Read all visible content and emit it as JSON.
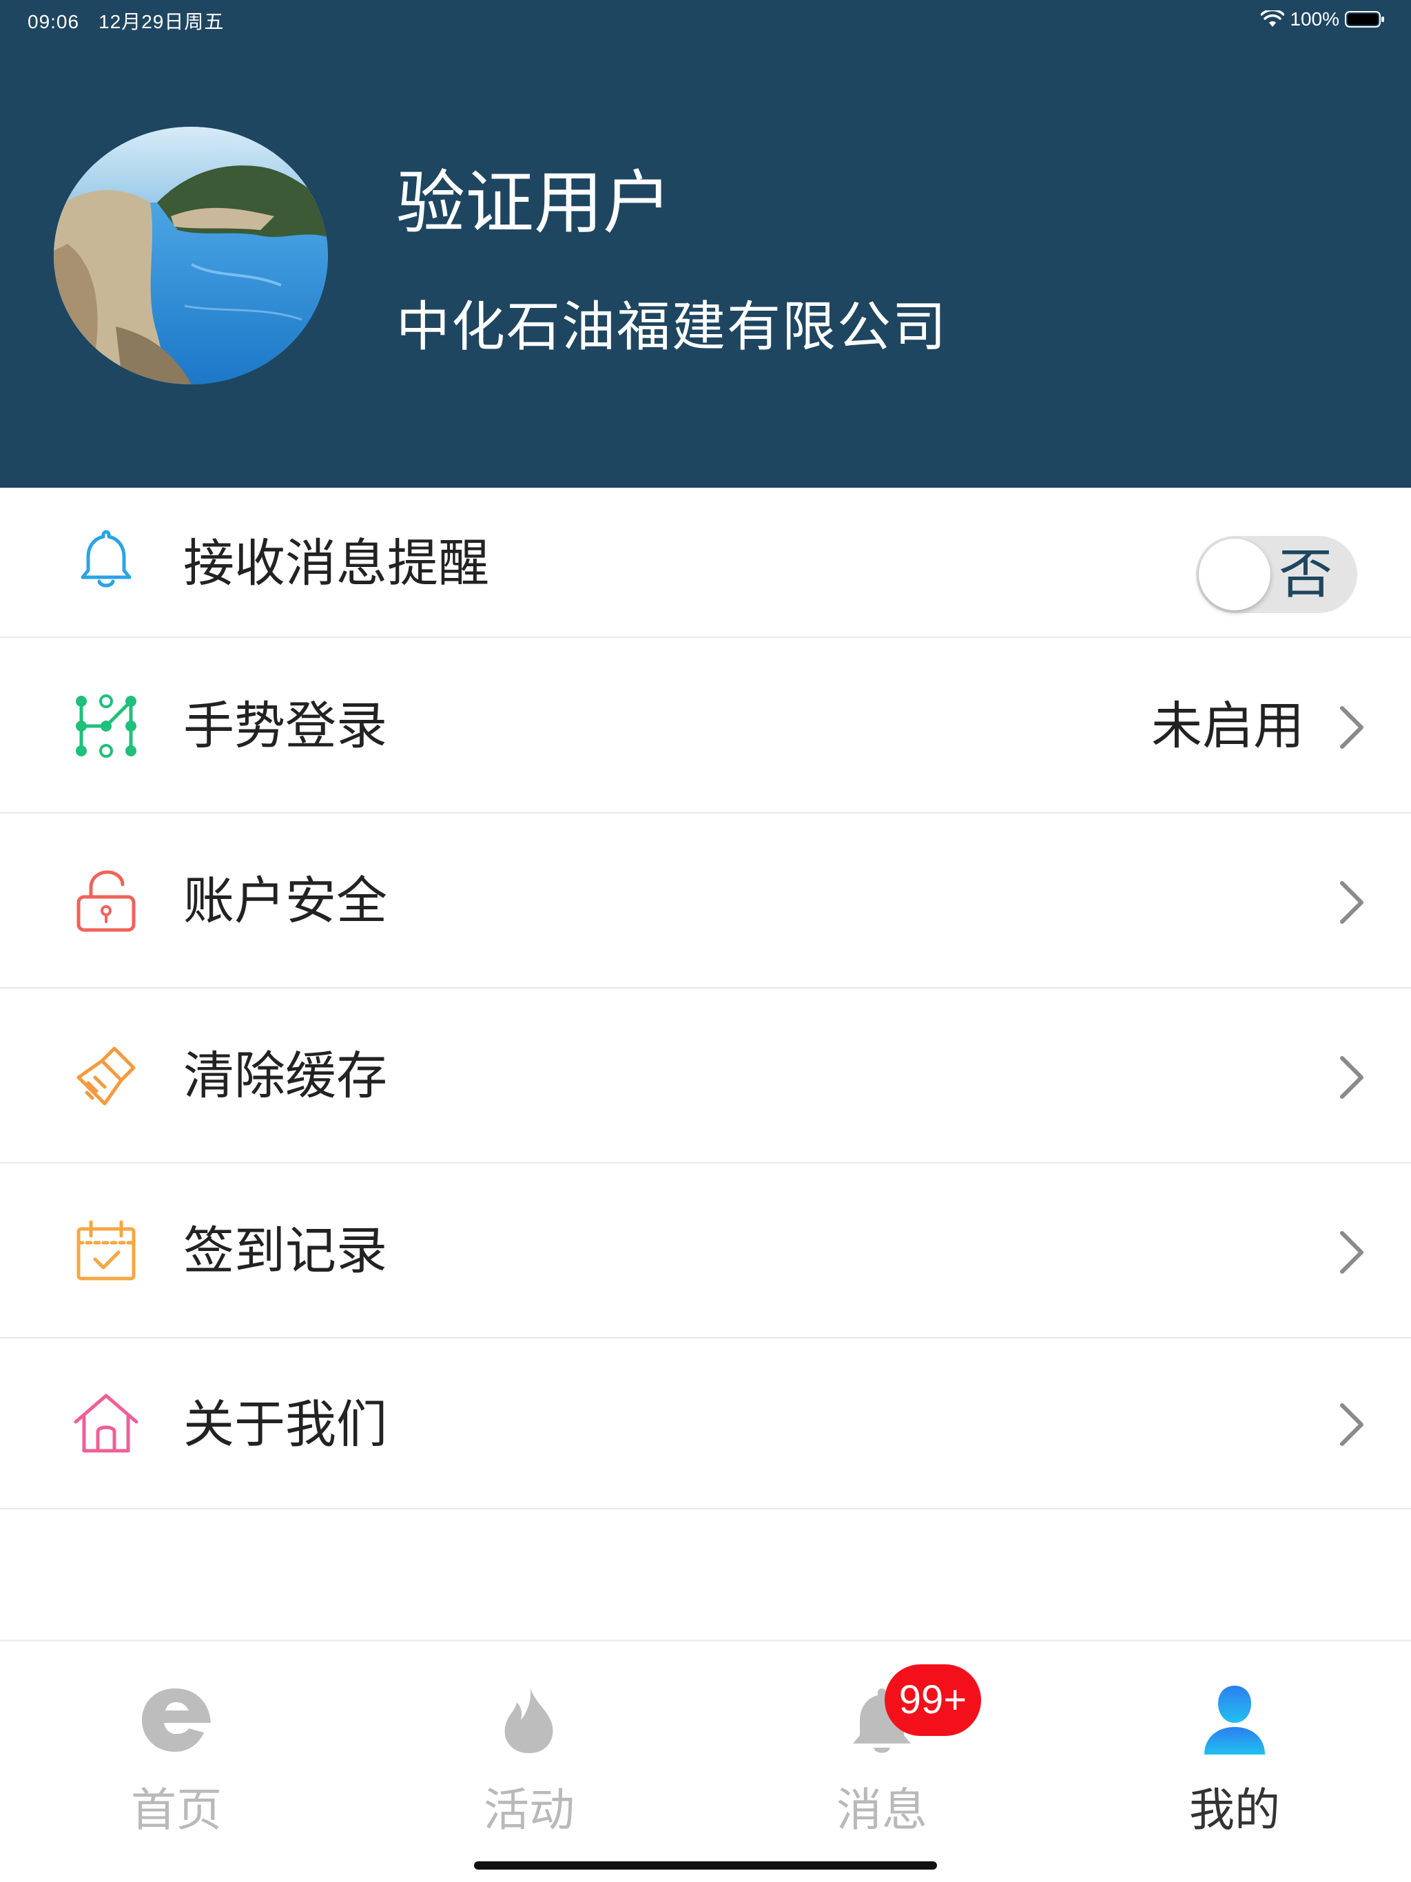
{
  "status_bar": {
    "time": "09:06",
    "date": "12月29日周五",
    "battery": "100%"
  },
  "profile": {
    "name": "验证用户",
    "company": "中化石油福建有限公司"
  },
  "settings": {
    "notifications": {
      "label": "接收消息提醒",
      "toggle_text": "否",
      "enabled": false,
      "icon": "bell-icon"
    },
    "gesture_login": {
      "label": "手势登录",
      "value": "未启用",
      "icon": "gesture-pattern-icon"
    },
    "account_security": {
      "label": "账户安全",
      "icon": "lock-icon"
    },
    "clear_cache": {
      "label": "清除缓存",
      "icon": "broom-icon"
    },
    "checkin_records": {
      "label": "签到记录",
      "icon": "calendar-check-icon"
    },
    "about_us": {
      "label": "关于我们",
      "icon": "house-icon"
    }
  },
  "tabbar": {
    "tabs": [
      {
        "label": "首页",
        "icon": "e-logo-icon",
        "active": false
      },
      {
        "label": "活动",
        "icon": "flame-icon",
        "active": false
      },
      {
        "label": "消息",
        "icon": "bell-icon",
        "active": false
      },
      {
        "label": "我的",
        "icon": "user-icon",
        "active": true
      }
    ],
    "message_badge": "99+"
  },
  "colors": {
    "header_bg": "#1f4660",
    "active_tab_icon": "#2b9ef0",
    "badge": "#f4101b",
    "bell_icon": "#2aa3e6",
    "gesture_icon": "#1fc07a",
    "lock_icon": "#f0625a",
    "broom_icon": "#f59a3e",
    "calendar_icon": "#f5a742",
    "house_icon": "#ee5f98"
  }
}
